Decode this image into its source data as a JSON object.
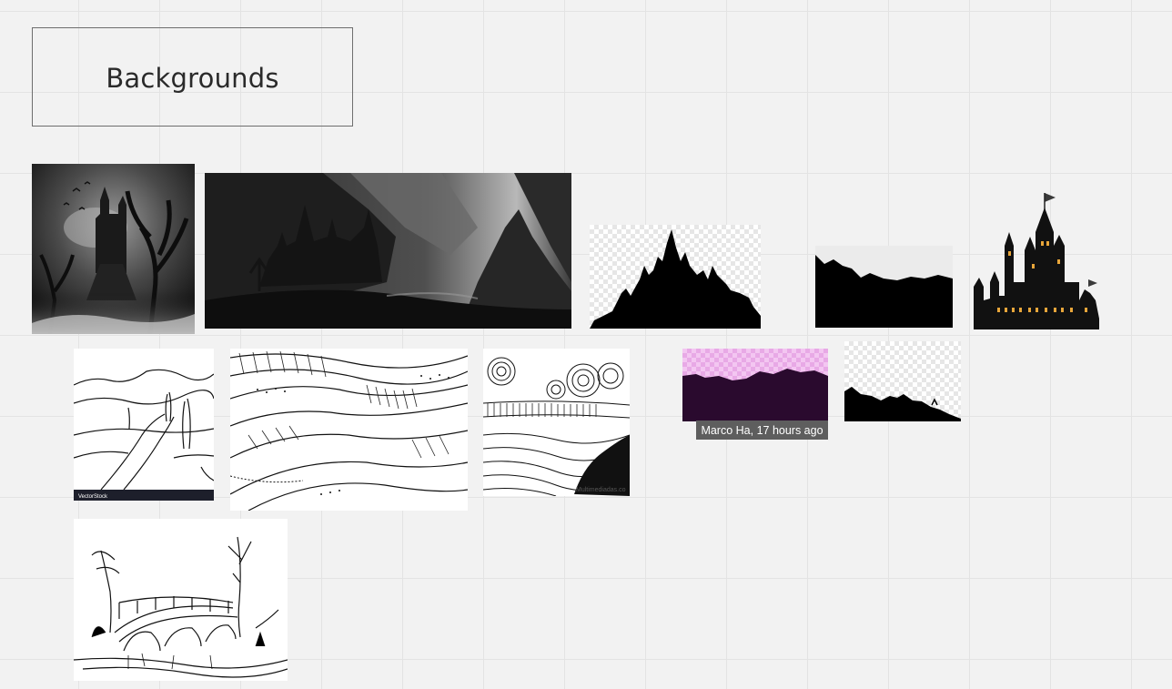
{
  "board": {
    "frame_title": "Backgrounds"
  },
  "images": [
    {
      "name": "dark-castle-tree-image",
      "description_icon": "image"
    },
    {
      "name": "dark-castle-canyon-image",
      "description_icon": "image"
    },
    {
      "name": "castle-silhouette-image",
      "description_icon": "image"
    },
    {
      "name": "cliff-silhouette-image",
      "description_icon": "image"
    },
    {
      "name": "castle-lit-windows-image",
      "description_icon": "image"
    },
    {
      "name": "road-landscape-sketch-image",
      "description_icon": "image"
    },
    {
      "name": "zentangle-hills-image",
      "description_icon": "image"
    },
    {
      "name": "zentangle-river-image",
      "description_icon": "image"
    },
    {
      "name": "mountain-silhouette-pink-image",
      "description_icon": "image"
    },
    {
      "name": "hill-silhouette-image",
      "description_icon": "image"
    },
    {
      "name": "stone-bridge-sketch-image",
      "description_icon": "image"
    }
  ],
  "watermarks": {
    "vectorstock_brand": "VectorStock",
    "multimedia_credit": "Multimediadas.co"
  },
  "tooltip": {
    "text": "Marco Ha, 17 hours ago"
  },
  "colors": {
    "canvas": "#f2f2f2",
    "grid": "#e3e3e3",
    "silhouette_purple": "#2a0a2e",
    "tooltip_bg": "#5e5e5e"
  }
}
